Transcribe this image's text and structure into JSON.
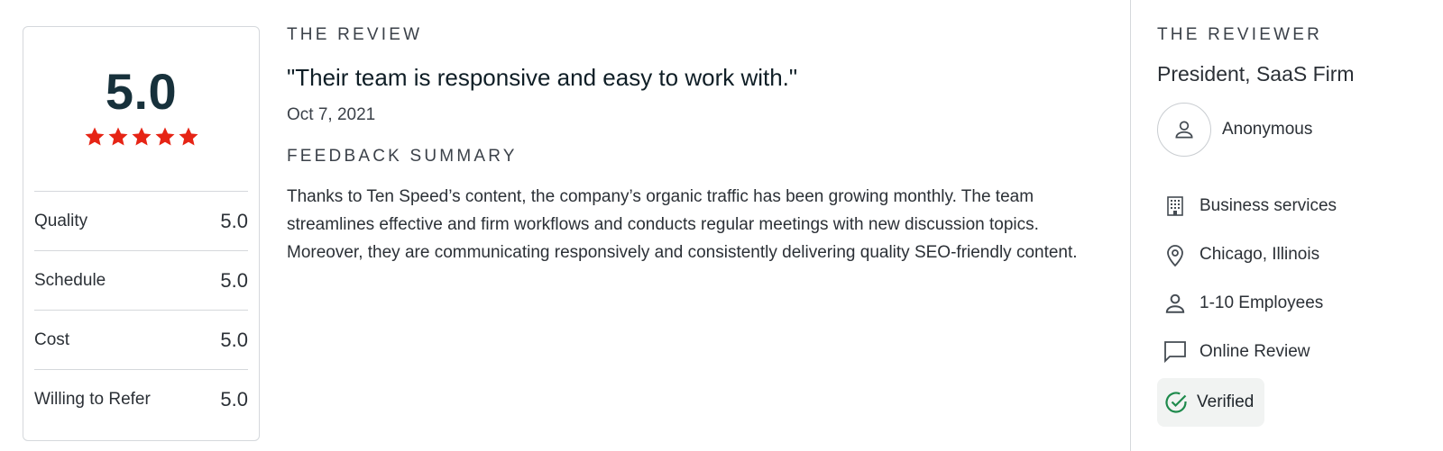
{
  "rating": {
    "overall": "5.0",
    "stars": 5,
    "star_color": "#e62415",
    "metrics": [
      {
        "label": "Quality",
        "value": "5.0"
      },
      {
        "label": "Schedule",
        "value": "5.0"
      },
      {
        "label": "Cost",
        "value": "5.0"
      },
      {
        "label": "Willing to Refer",
        "value": "5.0"
      }
    ]
  },
  "review": {
    "section_label": "THE REVIEW",
    "quote": "\"Their team is responsive and easy to work with.\"",
    "date": "Oct 7, 2021",
    "summary_label": "FEEDBACK SUMMARY",
    "summary": "Thanks to Ten Speed’s content, the company’s organic traffic has been growing monthly. The team streamlines effective and firm workflows and conducts regular meetings with new discussion topics. Moreover, they are communicating responsively and consistently delivering quality SEO-friendly content."
  },
  "reviewer": {
    "section_label": "THE REVIEWER",
    "title": "President, SaaS Firm",
    "name": "Anonymous",
    "details": [
      {
        "icon": "building-icon",
        "text": "Business services"
      },
      {
        "icon": "location-pin-icon",
        "text": "Chicago, Illinois"
      },
      {
        "icon": "person-icon",
        "text": "1-10 Employees"
      },
      {
        "icon": "chat-bubble-icon",
        "text": "Online Review"
      }
    ],
    "verified": {
      "icon": "check-circle-icon",
      "text": "Verified",
      "color": "#1e8a4c"
    }
  }
}
